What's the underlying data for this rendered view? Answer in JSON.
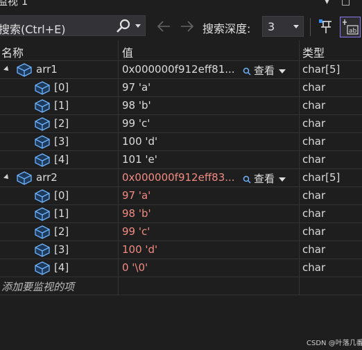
{
  "window": {
    "title": "监视 1"
  },
  "toolbar": {
    "search_placeholder": "搜索(Ctrl+E)",
    "depth_label": "搜索深度:",
    "depth_value": "3"
  },
  "columns": {
    "name": "名称",
    "value": "值",
    "type": "类型"
  },
  "rows": [
    {
      "level": 0,
      "expanded": true,
      "name": "arr1",
      "value": "0x000000f912eff81...",
      "type": "char[5]",
      "changed": false,
      "view": "查看"
    },
    {
      "level": 1,
      "name": "[0]",
      "value": "97 'a'",
      "type": "char",
      "changed": false
    },
    {
      "level": 1,
      "name": "[1]",
      "value": "98 'b'",
      "type": "char",
      "changed": false
    },
    {
      "level": 1,
      "name": "[2]",
      "value": "99 'c'",
      "type": "char",
      "changed": false
    },
    {
      "level": 1,
      "name": "[3]",
      "value": "100 'd'",
      "type": "char",
      "changed": false
    },
    {
      "level": 1,
      "name": "[4]",
      "value": "101 'e'",
      "type": "char",
      "changed": false
    },
    {
      "level": 0,
      "expanded": true,
      "name": "arr2",
      "value": "0x000000f912eff83...",
      "type": "char[5]",
      "changed": true,
      "view": "查看"
    },
    {
      "level": 1,
      "name": "[0]",
      "value": "97 'a'",
      "type": "char",
      "changed": true
    },
    {
      "level": 1,
      "name": "[1]",
      "value": "98 'b'",
      "type": "char",
      "changed": true
    },
    {
      "level": 1,
      "name": "[2]",
      "value": "99 'c'",
      "type": "char",
      "changed": true
    },
    {
      "level": 1,
      "name": "[3]",
      "value": "100 'd'",
      "type": "char",
      "changed": true
    },
    {
      "level": 1,
      "name": "[4]",
      "value": "0 '\\0'",
      "type": "char",
      "changed": true
    }
  ],
  "add_row_text": "添加要监视的项",
  "watermark": "CSDN @叶落几番",
  "colors": {
    "background": "#1e1e1e",
    "changed_value": "#f28b82",
    "accent_border": "#8a7cf0"
  }
}
